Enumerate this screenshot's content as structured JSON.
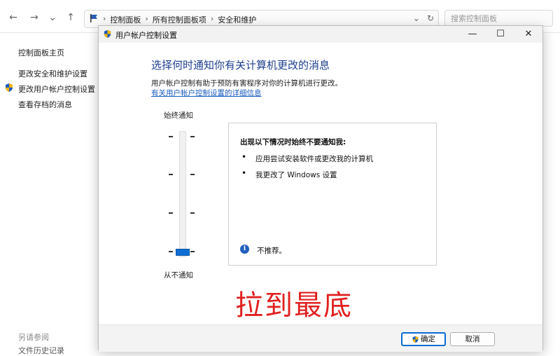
{
  "explorer": {
    "breadcrumb": [
      "控制面板",
      "所有控制面板项",
      "安全和维护"
    ],
    "search_placeholder": "搜索控制面板",
    "left_links": [
      "控制面板主页",
      "更改安全和维护设置",
      "更改用户帐户控制设置",
      "查看存档的消息"
    ],
    "see_also": "另请参阅",
    "see_also_item": "文件历史记录"
  },
  "dialog": {
    "title": "用户帐户控制设置",
    "heading": "选择何时通知你有关计算机更改的消息",
    "description": "用户帐户控制有助于预防有害程序对你的计算机进行更改。",
    "learn_more": "有关用户帐户控制设置的详细信息",
    "slider": {
      "top_label": "始终通知",
      "bottom_label": "从不通知",
      "levels": 4,
      "selected_level": 1
    },
    "info_box": {
      "title": "出现以下情况时始终不要通知我:",
      "bullets": [
        "应用尝试安装软件或更改我的计算机",
        "我更改了 Windows 设置"
      ],
      "note": "不推荐。"
    },
    "ok_label": "确定",
    "cancel_label": "取消"
  },
  "annotation": "拉到最底",
  "colors": {
    "heading": "#1e3f8f",
    "link": "#1a5bbf",
    "slider_thumb": "#0a6dd3",
    "annotation": "#e02020"
  }
}
